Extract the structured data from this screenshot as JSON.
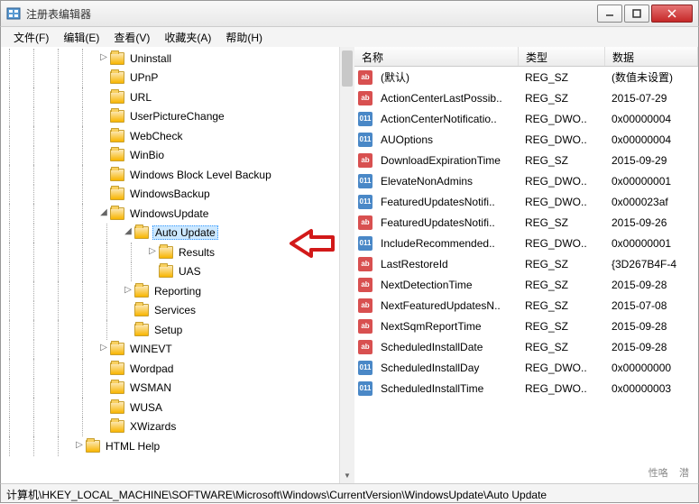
{
  "window": {
    "title": "注册表编辑器"
  },
  "menu": {
    "file": "文件(F)",
    "edit": "编辑(E)",
    "view": "查看(V)",
    "favorites": "收藏夹(A)",
    "help": "帮助(H)"
  },
  "tree": [
    {
      "indent": 4,
      "exp": "▷",
      "label": "Uninstall"
    },
    {
      "indent": 4,
      "exp": "",
      "label": "UPnP"
    },
    {
      "indent": 4,
      "exp": "",
      "label": "URL"
    },
    {
      "indent": 4,
      "exp": "",
      "label": "UserPictureChange"
    },
    {
      "indent": 4,
      "exp": "",
      "label": "WebCheck"
    },
    {
      "indent": 4,
      "exp": "",
      "label": "WinBio"
    },
    {
      "indent": 4,
      "exp": "",
      "label": "Windows Block Level Backup"
    },
    {
      "indent": 4,
      "exp": "",
      "label": "WindowsBackup"
    },
    {
      "indent": 4,
      "exp": "◢",
      "label": "WindowsUpdate"
    },
    {
      "indent": 5,
      "exp": "◢",
      "label": "Auto Update",
      "selected": true
    },
    {
      "indent": 6,
      "exp": "▷",
      "label": "Results"
    },
    {
      "indent": 6,
      "exp": "",
      "label": "UAS"
    },
    {
      "indent": 5,
      "exp": "▷",
      "label": "Reporting"
    },
    {
      "indent": 5,
      "exp": "",
      "label": "Services"
    },
    {
      "indent": 5,
      "exp": "",
      "label": "Setup"
    },
    {
      "indent": 4,
      "exp": "▷",
      "label": "WINEVT"
    },
    {
      "indent": 4,
      "exp": "",
      "label": "Wordpad"
    },
    {
      "indent": 4,
      "exp": "",
      "label": "WSMAN"
    },
    {
      "indent": 4,
      "exp": "",
      "label": "WUSA"
    },
    {
      "indent": 4,
      "exp": "",
      "label": "XWizards"
    },
    {
      "indent": 3,
      "exp": "▷",
      "label": "HTML Help"
    }
  ],
  "columns": {
    "name": "名称",
    "type": "类型",
    "data": "数据"
  },
  "values": [
    {
      "icon": "sz",
      "name": "(默认)",
      "type": "REG_SZ",
      "data": "(数值未设置)"
    },
    {
      "icon": "sz",
      "name": "ActionCenterLastPossib..",
      "type": "REG_SZ",
      "data": "2015-07-29"
    },
    {
      "icon": "dw",
      "name": "ActionCenterNotificatio..",
      "type": "REG_DWO..",
      "data": "0x00000004"
    },
    {
      "icon": "dw",
      "name": "AUOptions",
      "type": "REG_DWO..",
      "data": "0x00000004"
    },
    {
      "icon": "sz",
      "name": "DownloadExpirationTime",
      "type": "REG_SZ",
      "data": "2015-09-29"
    },
    {
      "icon": "dw",
      "name": "ElevateNonAdmins",
      "type": "REG_DWO..",
      "data": "0x00000001"
    },
    {
      "icon": "dw",
      "name": "FeaturedUpdatesNotifi..",
      "type": "REG_DWO..",
      "data": "0x000023af"
    },
    {
      "icon": "sz",
      "name": "FeaturedUpdatesNotifi..",
      "type": "REG_SZ",
      "data": "2015-09-26"
    },
    {
      "icon": "dw",
      "name": "IncludeRecommended..",
      "type": "REG_DWO..",
      "data": "0x00000001"
    },
    {
      "icon": "sz",
      "name": "LastRestoreId",
      "type": "REG_SZ",
      "data": "{3D267B4F-4"
    },
    {
      "icon": "sz",
      "name": "NextDetectionTime",
      "type": "REG_SZ",
      "data": "2015-09-28"
    },
    {
      "icon": "sz",
      "name": "NextFeaturedUpdatesN..",
      "type": "REG_SZ",
      "data": "2015-07-08"
    },
    {
      "icon": "sz",
      "name": "NextSqmReportTime",
      "type": "REG_SZ",
      "data": "2015-09-28"
    },
    {
      "icon": "sz",
      "name": "ScheduledInstallDate",
      "type": "REG_SZ",
      "data": "2015-09-28"
    },
    {
      "icon": "dw",
      "name": "ScheduledInstallDay",
      "type": "REG_DWO..",
      "data": "0x00000000"
    },
    {
      "icon": "dw",
      "name": "ScheduledInstallTime",
      "type": "REG_DWO..",
      "data": "0x00000003"
    }
  ],
  "statusbar": "计算机\\HKEY_LOCAL_MACHINE\\SOFTWARE\\Microsoft\\Windows\\CurrentVersion\\WindowsUpdate\\Auto Update"
}
